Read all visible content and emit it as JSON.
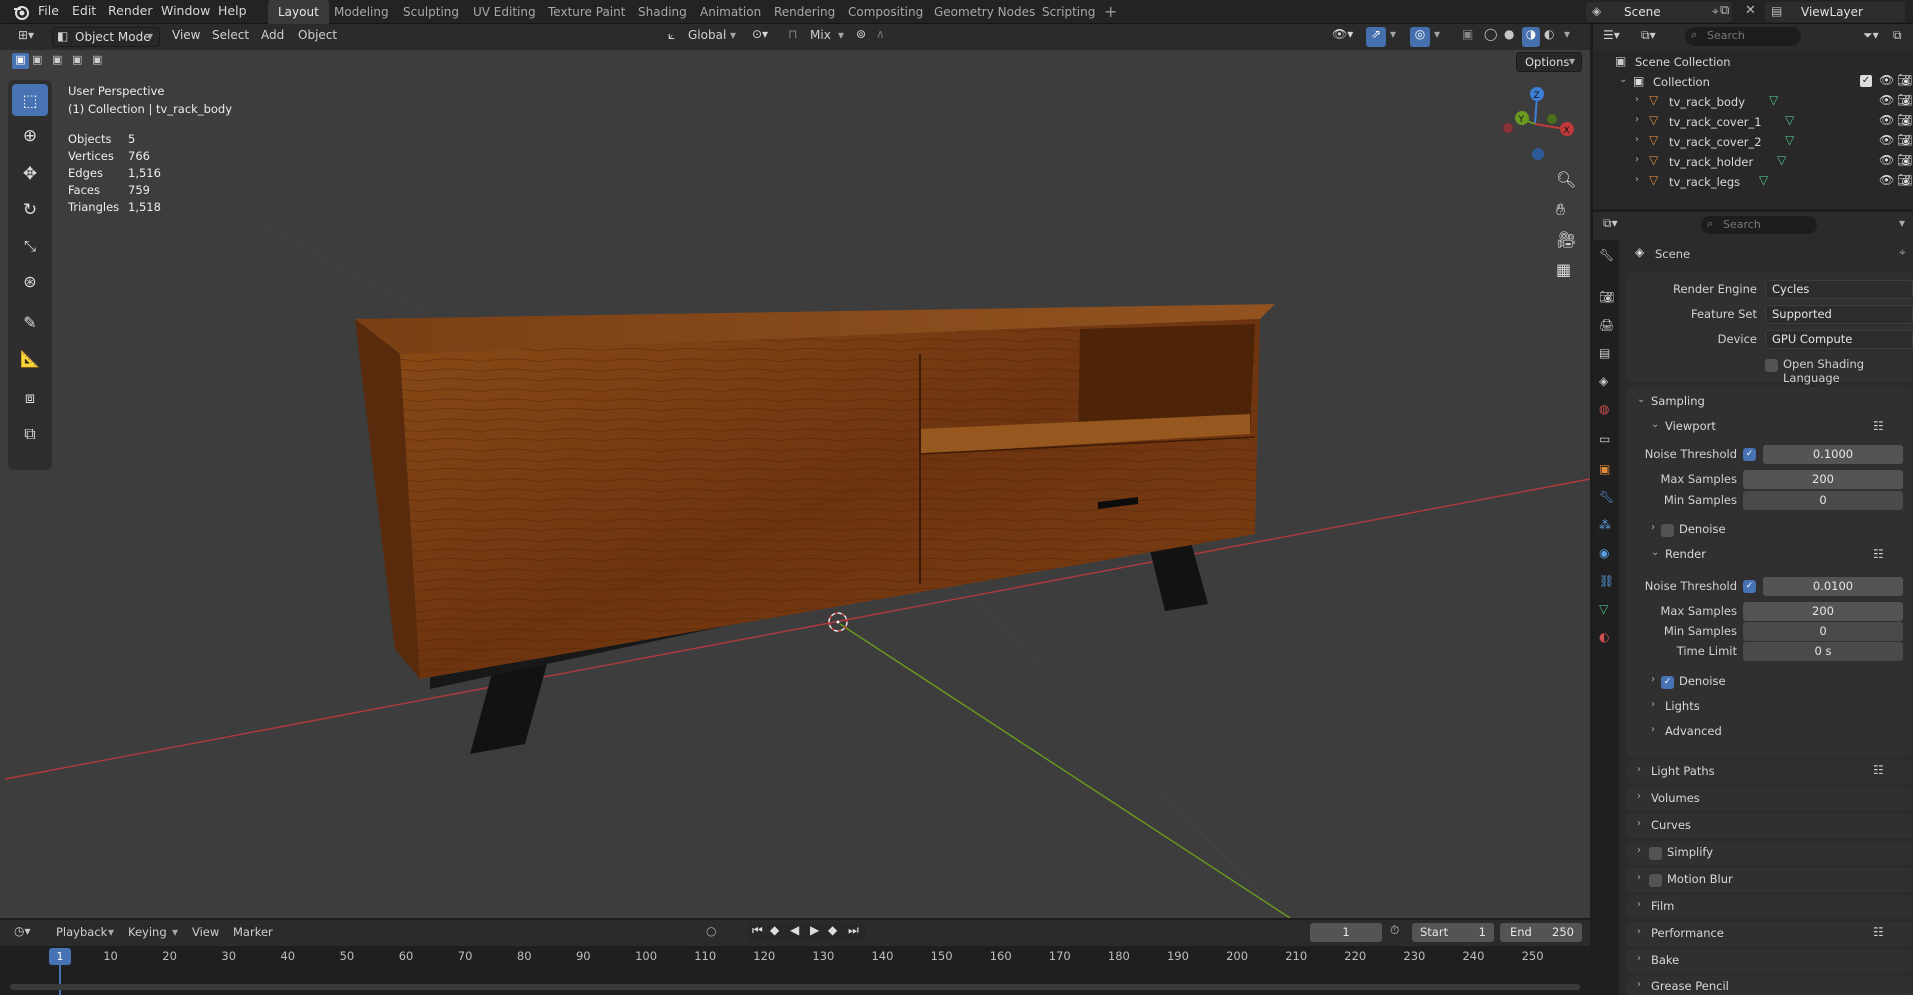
{
  "menu": [
    "File",
    "Edit",
    "Render",
    "Window",
    "Help"
  ],
  "workspaces": [
    "Layout",
    "Modeling",
    "Sculpting",
    "UV Editing",
    "Texture Paint",
    "Shading",
    "Animation",
    "Rendering",
    "Compositing",
    "Geometry Nodes",
    "Scripting"
  ],
  "active_workspace": "Layout",
  "scene_name": "Scene",
  "view_layer": "ViewLayer",
  "viewport_header": {
    "mode": "Object Mode",
    "menus": [
      "View",
      "Select",
      "Add",
      "Object"
    ],
    "orientation": "Global",
    "snap": "Mix",
    "options": "Options"
  },
  "overlay_info": {
    "perspective": "User Perspective",
    "collection": "(1) Collection | tv_rack_body",
    "stats": [
      {
        "label": "Objects",
        "value": "5"
      },
      {
        "label": "Vertices",
        "value": "766"
      },
      {
        "label": "Edges",
        "value": "1,516"
      },
      {
        "label": "Faces",
        "value": "759"
      },
      {
        "label": "Triangles",
        "value": "1,518"
      }
    ]
  },
  "gizmo": {
    "x": "X",
    "y": "Y",
    "z": "Z"
  },
  "outliner": {
    "search_placeholder": "Search",
    "scene_collection": "Scene Collection",
    "collection": "Collection",
    "objects": [
      "tv_rack_body",
      "tv_rack_cover_1",
      "tv_rack_cover_2",
      "tv_rack_holder",
      "tv_rack_legs"
    ]
  },
  "properties": {
    "search_placeholder": "Search",
    "context": "Scene",
    "render_engine": {
      "label": "Render Engine",
      "value": "Cycles"
    },
    "feature_set": {
      "label": "Feature Set",
      "value": "Supported"
    },
    "device": {
      "label": "Device",
      "value": "GPU Compute"
    },
    "osl": "Open Shading Language",
    "sampling": "Sampling",
    "viewport": {
      "title": "Viewport",
      "noise_threshold": {
        "label": "Noise Threshold",
        "value": "0.1000"
      },
      "max_samples": {
        "label": "Max Samples",
        "value": "200"
      },
      "min_samples": {
        "label": "Min Samples",
        "value": "0"
      },
      "denoise": "Denoise"
    },
    "render": {
      "title": "Render",
      "noise_threshold": {
        "label": "Noise Threshold",
        "value": "0.0100"
      },
      "max_samples": {
        "label": "Max Samples",
        "value": "200"
      },
      "min_samples": {
        "label": "Min Samples",
        "value": "0"
      },
      "time_limit": {
        "label": "Time Limit",
        "value": "0 s"
      },
      "denoise": "Denoise",
      "lights": "Lights",
      "advanced": "Advanced"
    },
    "sections": [
      "Light Paths",
      "Volumes",
      "Curves",
      "Simplify",
      "Motion Blur",
      "Film",
      "Performance",
      "Bake",
      "Grease Pencil"
    ]
  },
  "timeline": {
    "menus": [
      "Playback",
      "Keying",
      "View",
      "Marker"
    ],
    "current_frame": "1",
    "start_label": "Start",
    "start": "1",
    "end_label": "End",
    "end": "250",
    "ticks": [
      "1",
      "10",
      "20",
      "30",
      "40",
      "50",
      "60",
      "70",
      "80",
      "90",
      "100",
      "110",
      "120",
      "130",
      "140",
      "150",
      "160",
      "170",
      "180",
      "190",
      "200",
      "210",
      "220",
      "230",
      "240",
      "250"
    ]
  },
  "colors": {
    "accent": "#4772b3",
    "axis_x": "#c0393b",
    "axis_y": "#6a9a1f",
    "wood": "#7a3d12",
    "legs": "#121212"
  }
}
